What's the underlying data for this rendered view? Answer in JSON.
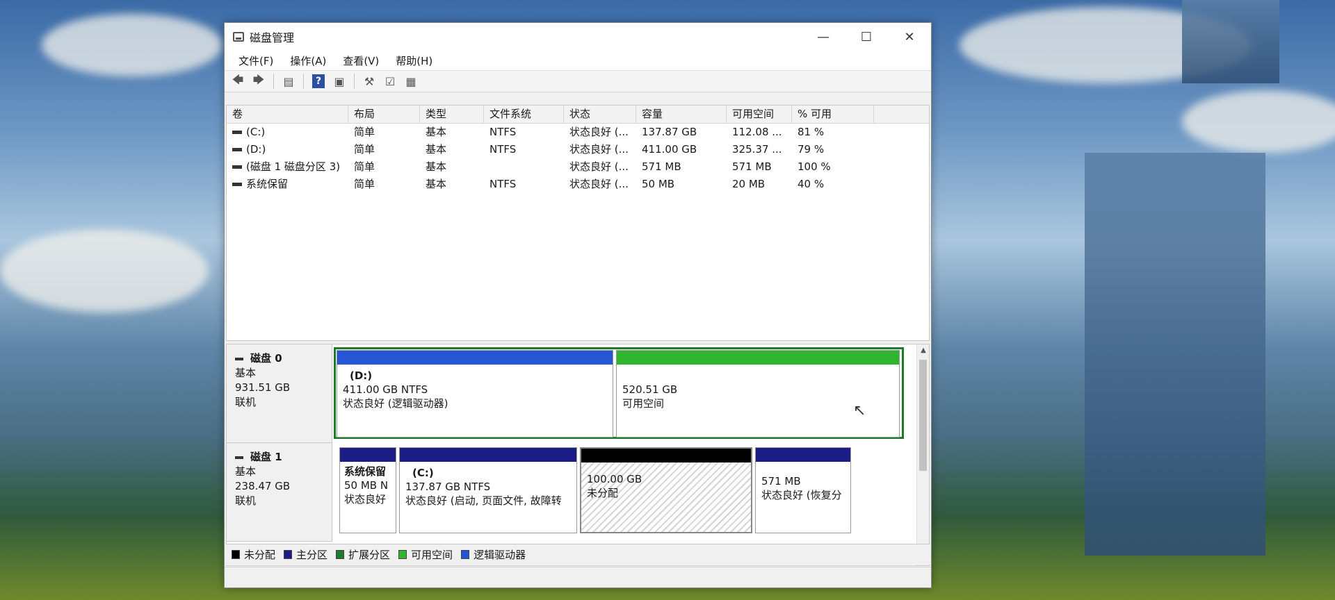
{
  "window": {
    "title": "磁盘管理"
  },
  "window_controls": {
    "minimize": "—",
    "maximize": "☐",
    "close": "✕"
  },
  "menu": [
    "文件(F)",
    "操作(A)",
    "查看(V)",
    "帮助(H)"
  ],
  "toolbar": {
    "help_label": "?"
  },
  "columns": [
    "卷",
    "布局",
    "类型",
    "文件系统",
    "状态",
    "容量",
    "可用空间",
    "% 可用"
  ],
  "volumes": [
    {
      "name": "(C:)",
      "layout": "简单",
      "type": "基本",
      "fs": "NTFS",
      "status": "状态良好 (...",
      "capacity": "137.87 GB",
      "free": "112.08 ...",
      "pct": "81 %"
    },
    {
      "name": "(D:)",
      "layout": "简单",
      "type": "基本",
      "fs": "NTFS",
      "status": "状态良好 (...",
      "capacity": "411.00 GB",
      "free": "325.37 ...",
      "pct": "79 %"
    },
    {
      "name": "(磁盘 1 磁盘分区 3)",
      "layout": "简单",
      "type": "基本",
      "fs": "",
      "status": "状态良好 (...",
      "capacity": "571 MB",
      "free": "571 MB",
      "pct": "100 %"
    },
    {
      "name": "系统保留",
      "layout": "简单",
      "type": "基本",
      "fs": "NTFS",
      "status": "状态良好 (...",
      "capacity": "50 MB",
      "free": "20 MB",
      "pct": "40 %"
    }
  ],
  "disks": [
    {
      "name": "磁盘 0",
      "type": "基本",
      "size": "931.51 GB",
      "state": "联机",
      "partitions": [
        {
          "title": "(D:)",
          "line1": "411.00 GB NTFS",
          "line2": "状态良好 (逻辑驱动器)",
          "color": "#2456d6"
        },
        {
          "title": "",
          "line1": "520.51 GB",
          "line2": "可用空间",
          "color": "#2fb52f"
        }
      ]
    },
    {
      "name": "磁盘 1",
      "type": "基本",
      "size": "238.47 GB",
      "state": "联机",
      "partitions": [
        {
          "title": "系统保留",
          "line1": "50 MB N",
          "line2": "状态良好",
          "color": "#1c1c86"
        },
        {
          "title": "(C:)",
          "line1": "137.87 GB NTFS",
          "line2": "状态良好 (启动, 页面文件, 故障转",
          "color": "#1c1c86"
        },
        {
          "title": "",
          "line1": "100.00 GB",
          "line2": "未分配",
          "color": "#000000"
        },
        {
          "title": "",
          "line1": "571 MB",
          "line2": "状态良好 (恢复分",
          "color": "#1c1c86"
        }
      ]
    }
  ],
  "legend": [
    {
      "label": "未分配",
      "color": "#000000"
    },
    {
      "label": "主分区",
      "color": "#1c1c86"
    },
    {
      "label": "扩展分区",
      "color": "#1f7a2a"
    },
    {
      "label": "可用空间",
      "color": "#2fb52f"
    },
    {
      "label": "逻辑驱动器",
      "color": "#2456d6"
    }
  ]
}
